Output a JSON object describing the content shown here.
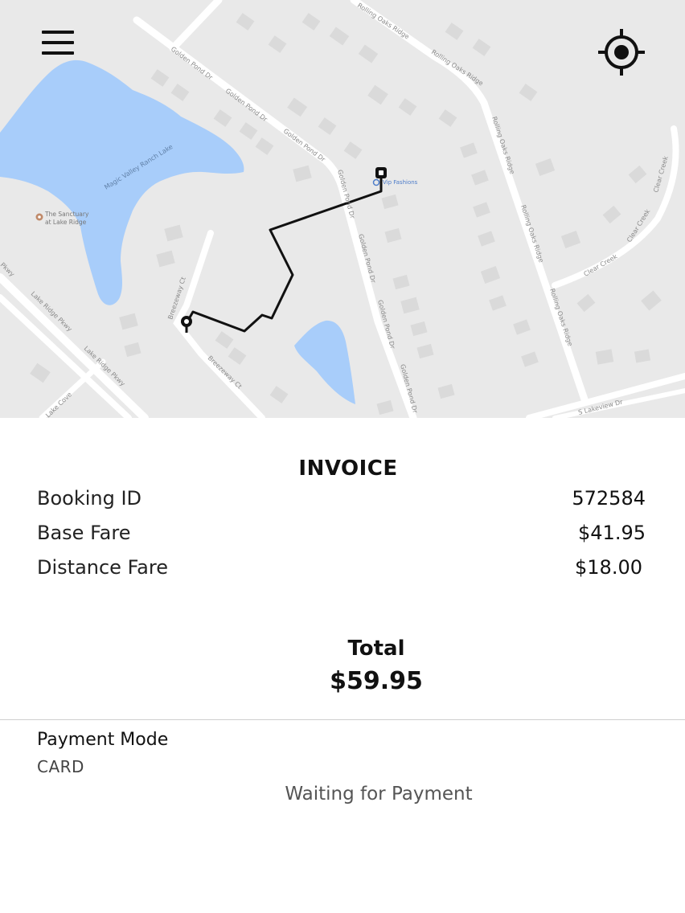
{
  "map": {
    "lake_label": "Magic Valley Ranch Lake",
    "poi_label_line1": "The Sanctuary",
    "poi_label_line2": "at Lake Ridge",
    "shop_label": "Vip Fashions",
    "roads": {
      "rolling_oaks_ridge": "Rolling Oaks Ridge",
      "golden_pond_dr": "Golden Pond Dr",
      "lake_ridge_pkwy": "Lake Ridge Pkwy",
      "breezeway_ct": "Breezeway Ct",
      "clear_creek": "Clear Creek",
      "s_lakeview_dr": "S Lakeview Dr",
      "lake_cove": "Lake Cove",
      "pkwy": "Pkwy"
    },
    "colors": {
      "land": "#e9e9e9",
      "water": "#a8cdfa",
      "road": "#ffffff",
      "route": "#111111"
    }
  },
  "toolbar": {
    "menu_icon": "hamburger-menu-icon",
    "locate_icon": "crosshair-locate-icon"
  },
  "invoice": {
    "title": "INVOICE",
    "rows": [
      {
        "label": "Booking ID",
        "value": "572584"
      },
      {
        "label": "Base Fare",
        "value": "$41.95"
      },
      {
        "label": "Distance Fare",
        "value": "$18.00"
      }
    ],
    "total_label": "Total",
    "total_value": "$59.95",
    "payment_mode_label": "Payment Mode",
    "payment_mode_value": "CARD",
    "status": "Waiting for Payment"
  }
}
